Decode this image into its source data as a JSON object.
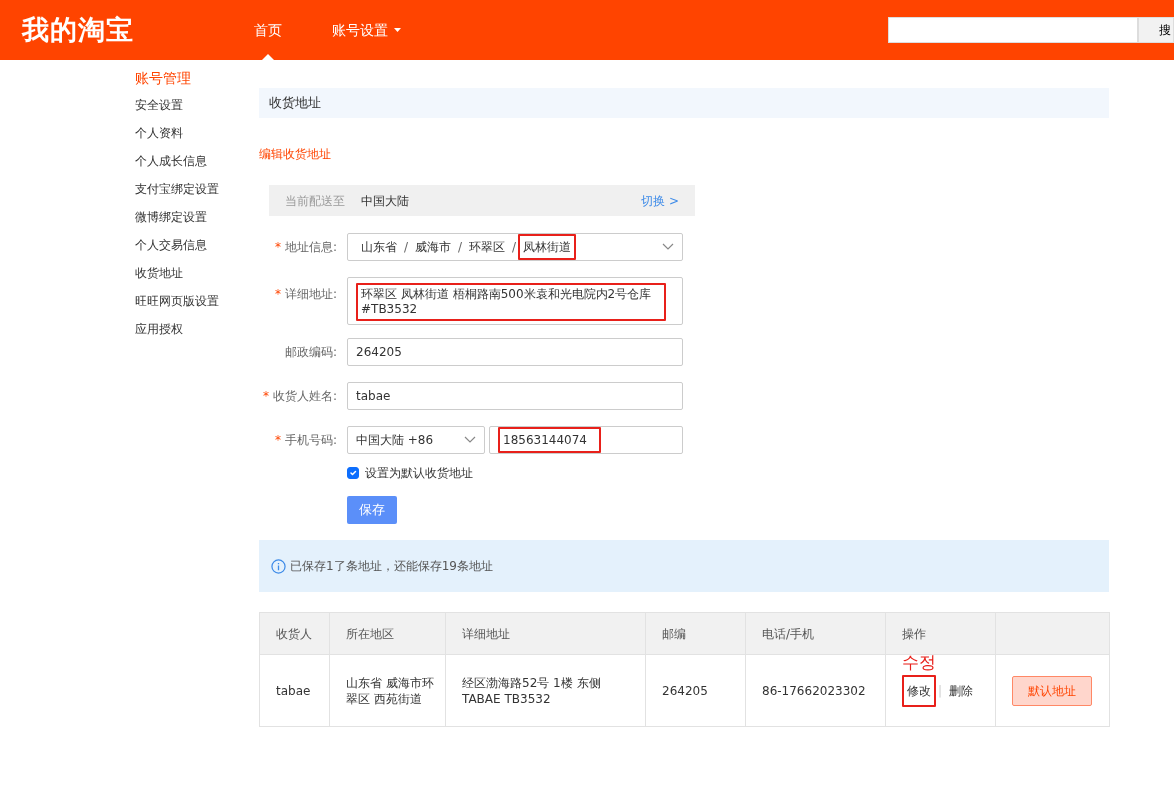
{
  "header": {
    "logo": "我的淘宝",
    "nav": [
      {
        "label": "首页",
        "selected": true,
        "dropdown": false
      },
      {
        "label": "账号设置",
        "selected": false,
        "dropdown": true
      }
    ],
    "search": {
      "button": "搜"
    }
  },
  "sidebar": {
    "title": "账号管理",
    "items": [
      {
        "label": "安全设置"
      },
      {
        "label": "个人资料"
      },
      {
        "label": "个人成长信息"
      },
      {
        "label": "支付宝绑定设置"
      },
      {
        "label": "微博绑定设置"
      },
      {
        "label": "个人交易信息"
      },
      {
        "label": "收货地址"
      },
      {
        "label": "旺旺网页版设置"
      },
      {
        "label": "应用授权"
      }
    ]
  },
  "page_title": "收货地址",
  "section_link": "编辑收货地址",
  "delivery": {
    "label": "当前配送至",
    "value": "中国大陆",
    "switch": "切换 >"
  },
  "form": {
    "required_mark": "*",
    "region": {
      "label": "地址信息:",
      "required": true,
      "separator": "/",
      "parts": [
        {
          "text": "山东省",
          "highlighted": false
        },
        {
          "text": "威海市",
          "highlighted": false
        },
        {
          "text": "环翠区",
          "highlighted": false
        },
        {
          "text": "凤林街道",
          "highlighted": true
        }
      ]
    },
    "detail": {
      "label": "详细地址:",
      "required": true,
      "value": "环翠区 凤林街道 梧桐路南500米袁和光电院内2号仓库 #TB3532",
      "highlighted": true
    },
    "postcode": {
      "label": "邮政编码:",
      "required": false,
      "value": "264205"
    },
    "name": {
      "label": "收货人姓名:",
      "required": true,
      "value": "tabae"
    },
    "phone": {
      "label": "手机号码:",
      "required": true,
      "country": "中国大陆 +86",
      "value": "18563144074",
      "highlighted": true
    },
    "default": {
      "label": "设置为默认收货地址",
      "checked": true
    },
    "save": "保存"
  },
  "notice": "已保存1了条地址，还能保存19条地址",
  "table": {
    "columns": [
      "收货人",
      "所在地区",
      "详细地址",
      "邮编",
      "电话/手机",
      "操作",
      ""
    ],
    "rows": [
      {
        "separator": "|",
        "cells": [
          "tabae",
          "山东省 威海市环翠区 西苑街道",
          "经区渤海路52号 1楼 东侧 TABAE TB3532",
          "264205",
          "86-17662023302"
        ],
        "actions": [
          {
            "label": "修改",
            "highlighted": true,
            "note": "수정"
          },
          {
            "label": "删除",
            "highlighted": false
          }
        ],
        "default_button": "默认地址"
      }
    ]
  }
}
